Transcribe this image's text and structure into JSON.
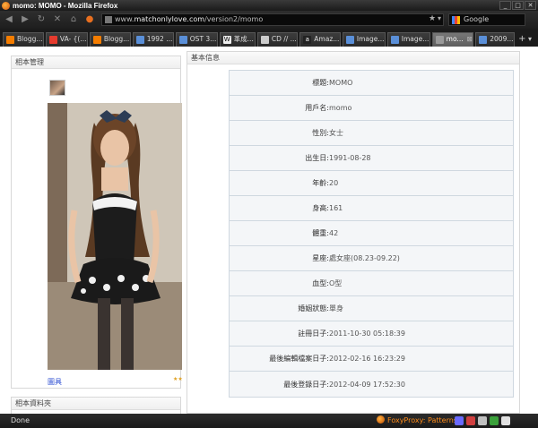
{
  "window": {
    "title": "momo: MOMO - Mozilla Firefox",
    "minimize": "_",
    "maximize": "□",
    "close": "✕"
  },
  "nav": {
    "url_prefix": "www.",
    "url_domain": "matchonlylove.com",
    "url_path": "/version2/momo",
    "search_engine": "Google"
  },
  "tabs": [
    {
      "label": "Blogg...",
      "icon_color": "#f57d00",
      "icon": "blogger-icon"
    },
    {
      "label": "VA- {(...",
      "icon_color": "#e63b2e",
      "icon": "site-icon"
    },
    {
      "label": "Blogg...",
      "icon_color": "#f57d00",
      "icon": "blogger-icon"
    },
    {
      "label": "1992 ...",
      "icon_color": "#5a8fd8",
      "icon": "page-icon"
    },
    {
      "label": "OST 3...",
      "icon_color": "#5a8fd8",
      "icon": "page-icon"
    },
    {
      "label": "革成...",
      "icon_color": "#eeeeee",
      "icon": "wikipedia-icon"
    },
    {
      "label": "CD // ...",
      "icon_color": "#cccccc",
      "icon": "pen-icon"
    },
    {
      "label": "Amaz...",
      "icon_color": "#222222",
      "icon": "amazon-icon"
    },
    {
      "label": "Image...",
      "icon_color": "#5a8fd8",
      "icon": "page-icon"
    },
    {
      "label": "Image...",
      "icon_color": "#5a8fd8",
      "icon": "page-icon"
    },
    {
      "label": "mo...",
      "icon_color": "#999999",
      "icon": "page-icon",
      "active": true
    },
    {
      "label": "2009...",
      "icon_color": "#5a8fd8",
      "icon": "page-icon"
    }
  ],
  "left_panel": {
    "header": "相本管理",
    "album_link": "圖具",
    "rating": "★★",
    "second_header": "相本資料夾"
  },
  "right_panel": {
    "header": "基本信息",
    "rows": [
      {
        "label": "標題:",
        "value": "MOMO"
      },
      {
        "label": "用戶名:",
        "value": "momo"
      },
      {
        "label": "性別:",
        "value": "女士"
      },
      {
        "label": "出生日:",
        "value": "1991-08-28"
      },
      {
        "label": "年齡:",
        "value": "20"
      },
      {
        "label": "身高:",
        "value": "161"
      },
      {
        "label": "體重:",
        "value": "42"
      },
      {
        "label": "星座:",
        "value": "處女座(08.23-09.22)"
      },
      {
        "label": "血型:",
        "value": "O型"
      },
      {
        "label": "婚姻狀態:",
        "value": "單身"
      },
      {
        "label": "註冊日子:",
        "value": "2011-10-30 05:18:39"
      },
      {
        "label": "最後編輯檔案日子:",
        "value": "2012-02-16 16:23:29"
      },
      {
        "label": "最後登錄日子:",
        "value": "2012-04-09 17:52:30"
      }
    ]
  },
  "status": {
    "text": "Done",
    "foxyproxy": "FoxyProxy: Patterns"
  }
}
